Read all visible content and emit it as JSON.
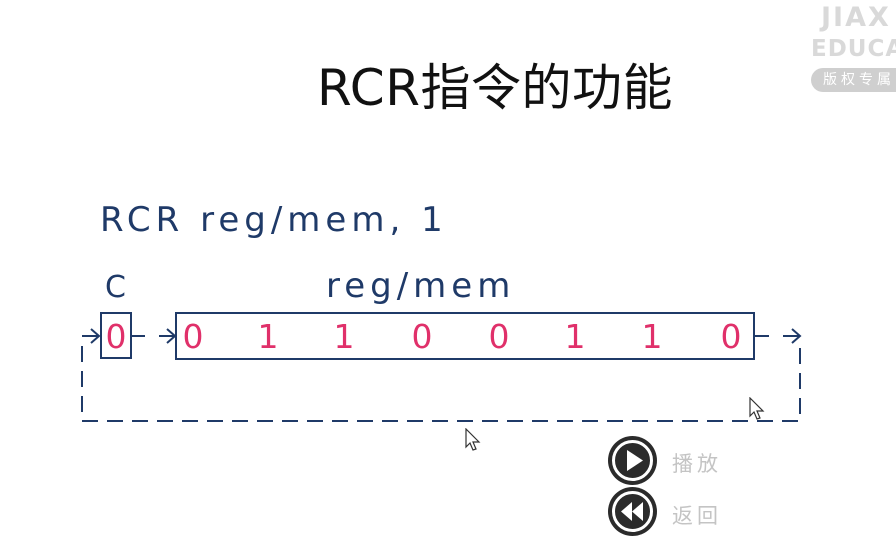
{
  "slide": {
    "title": "RCR指令的功能",
    "instruction": "RCR reg/mem, 1",
    "carry_label": "C",
    "register_label": "reg/mem",
    "carry_bit": "0",
    "register_bits": [
      "0",
      "1",
      "1",
      "0",
      "0",
      "1",
      "1",
      "0"
    ]
  },
  "watermark": {
    "line1": "JIAX",
    "line2": "EDUCAT",
    "line3": "版权专属"
  },
  "controls": {
    "play_label": "播放",
    "back_label": "返回"
  },
  "colors": {
    "diagram_blue": "#1f3a68",
    "bit_pink": "#e0306a",
    "button_dark": "#2b2b2b",
    "label_gray": "#c4c4c4"
  }
}
